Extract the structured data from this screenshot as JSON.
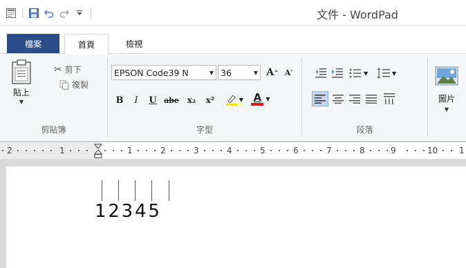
{
  "window": {
    "title": "文件 - WordPad"
  },
  "tabs": {
    "file": "檔案",
    "home": "首頁",
    "view": "檢視"
  },
  "clipboard": {
    "paste": "貼上",
    "cut": "剪下",
    "copy": "複製",
    "group_label": "剪貼簿"
  },
  "font": {
    "family": "EPSON Code39 N",
    "size": "36",
    "bold": "B",
    "italic": "I",
    "underline": "U",
    "strikethrough": "abe",
    "subscript": "x₂",
    "superscript": "x²",
    "highlight_color": "#f5e400",
    "text_color_mark": "A",
    "text_color": "#d7191c",
    "group_label": "字型"
  },
  "paragraph": {
    "group_label": "段落"
  },
  "insert": {
    "picture": "圖片"
  },
  "ruler": {
    "labels": [
      "2",
      "1",
      "1",
      "2",
      "3",
      "4",
      "5",
      "6",
      "7",
      "8",
      "9",
      "10",
      "1"
    ]
  },
  "document": {
    "text": "12345"
  }
}
